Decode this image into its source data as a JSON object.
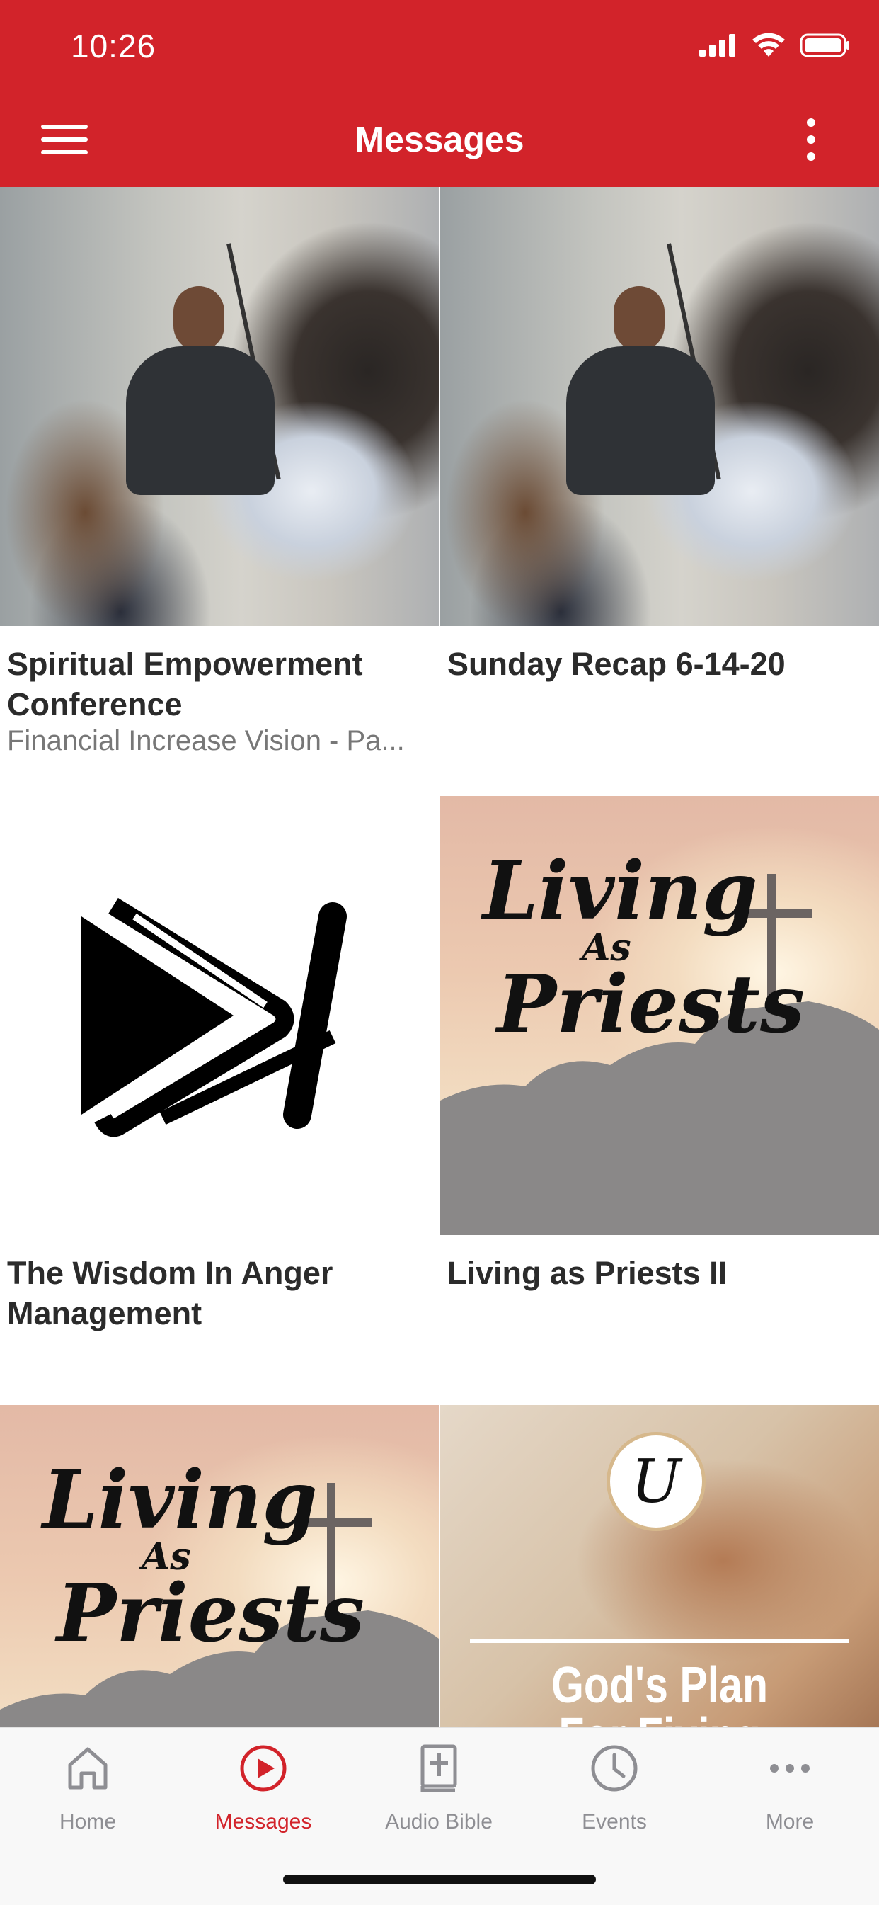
{
  "status_bar": {
    "time": "10:26"
  },
  "header": {
    "title": "Messages"
  },
  "colors": {
    "brand": "#d2232a",
    "tab_inactive": "#8e8e93",
    "title_text": "#2b2b2b",
    "subtitle_text": "#777777"
  },
  "cards": [
    {
      "title": "Spiritual Empowerment Conference",
      "subtitle": "Financial Increase Vision - Pa..."
    },
    {
      "title": "Sunday Recap 6-14-20",
      "subtitle": ""
    },
    {
      "title": "The Wisdom In Anger Management",
      "subtitle": ""
    },
    {
      "title": "Living as Priests II",
      "subtitle": ""
    },
    {
      "thumb_text": {
        "line1": "Living",
        "line2": "As",
        "line3": "Priests"
      }
    },
    {
      "thumb_text": {
        "badge": "U",
        "title_line1": "God's Plan",
        "title_line2": "For Fixing"
      }
    }
  ],
  "thumb_text": {
    "line1": "Living",
    "line2": "As",
    "line3": "Priests"
  },
  "tabs": [
    {
      "label": "Home",
      "icon": "home-icon",
      "active": false
    },
    {
      "label": "Messages",
      "icon": "play-circle-icon",
      "active": true
    },
    {
      "label": "Audio Bible",
      "icon": "bible-icon",
      "active": false
    },
    {
      "label": "Events",
      "icon": "clock-icon",
      "active": false
    },
    {
      "label": "More",
      "icon": "ellipsis-icon",
      "active": false
    }
  ]
}
